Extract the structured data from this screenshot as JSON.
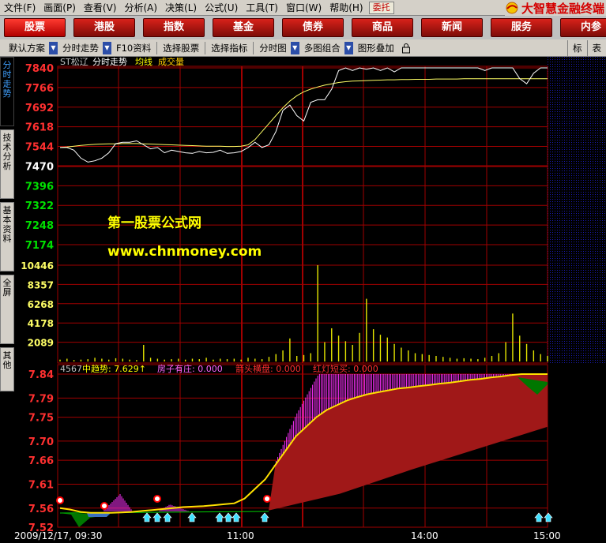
{
  "menu": [
    "文件(F)",
    "画面(P)",
    "查看(V)",
    "分析(A)",
    "决策(L)",
    "公式(U)",
    "工具(T)",
    "窗口(W)",
    "帮助(H)"
  ],
  "entrust": "委托",
  "brand": "大智慧金融终端",
  "nav": [
    "股票",
    "港股",
    "指数",
    "基金",
    "债券",
    "商品",
    "新闻",
    "服务",
    "内参"
  ],
  "toolbar": {
    "default_scheme": "默认方案",
    "timeshare": "分时走势",
    "f10": "F10资料",
    "select_stock": "选择股票",
    "select_indicator": "选择指标",
    "timeshare_chart": "分时图",
    "multi_combo": "多图组合",
    "overlay": "图形叠加",
    "mark": "标",
    "table": "表"
  },
  "side_tabs": [
    "分时走势",
    "技术分析",
    "基本资料",
    "全屏",
    "其他"
  ],
  "upper": {
    "header": [
      "ST松辽",
      "分时走势",
      "均线",
      "成交量"
    ],
    "price_ticks": [
      "7840",
      "7766",
      "7692",
      "7618",
      "7544",
      "7470",
      "7396",
      "7322",
      "7248",
      "7174"
    ],
    "vol_ticks": [
      "10446",
      "8357",
      "6268",
      "4178",
      "2089"
    ]
  },
  "watermark": {
    "line1": "第一股票公式网",
    "line2": "www.chnmoney.com"
  },
  "lower": {
    "code": "4567",
    "ind1": "中趋势: 7.629↑",
    "ind2": "房子有庄: 0.000",
    "ind3": "箭头横盘: 0.000",
    "ind4": "红灯短买: 0.000",
    "ticks": [
      "7.84",
      "7.79",
      "7.75",
      "7.70",
      "7.66",
      "7.61",
      "7.56",
      "7.52"
    ]
  },
  "xaxis": {
    "date": "2009/12/17, 09:30",
    "t1": "11:00",
    "t2": "14:00",
    "t3": "15:00"
  },
  "colors": {
    "up": "#ff3030",
    "down": "#00e000",
    "grid": "#a00000",
    "volume": "#e6e600",
    "avg": "#ffff66",
    "price": "#ffffff",
    "trend": "#ffe000",
    "fill": "#a01818",
    "magenta": "#ff30ff",
    "green": "#007700"
  },
  "chart_data": {
    "type": "line",
    "price_y_range": [
      7140,
      7840
    ],
    "price": [
      7540,
      7540,
      7530,
      7500,
      7485,
      7490,
      7500,
      7520,
      7555,
      7560,
      7560,
      7565,
      7550,
      7535,
      7540,
      7520,
      7530,
      7525,
      7520,
      7518,
      7525,
      7520,
      7522,
      7530,
      7518,
      7520,
      7525,
      7540,
      7560,
      7540,
      7550,
      7600,
      7680,
      7700,
      7660,
      7640,
      7710,
      7720,
      7720,
      7760,
      7830,
      7840,
      7830,
      7840,
      7835,
      7840,
      7830,
      7840,
      7825,
      7840,
      7840,
      7840,
      7840,
      7840,
      7840,
      7840,
      7840,
      7840,
      7840,
      7840,
      7840,
      7830,
      7840,
      7840,
      7840,
      7840,
      7800,
      7780,
      7820,
      7840,
      7840
    ],
    "avg": [
      7540,
      7542,
      7545,
      7548,
      7550,
      7552,
      7553,
      7554,
      7554,
      7555,
      7555,
      7555,
      7554,
      7553,
      7552,
      7551,
      7550,
      7549,
      7548,
      7547,
      7546,
      7545,
      7545,
      7545,
      7544,
      7544,
      7545,
      7550,
      7570,
      7600,
      7630,
      7660,
      7690,
      7715,
      7735,
      7750,
      7760,
      7768,
      7775,
      7780,
      7785,
      7788,
      7790,
      7791,
      7792,
      7793,
      7794,
      7795,
      7795,
      7796,
      7796,
      7797,
      7797,
      7797,
      7798,
      7798,
      7798,
      7798,
      7799,
      7799,
      7799,
      7799,
      7799,
      7799,
      7799,
      7799,
      7799,
      7799,
      7799,
      7799,
      7799
    ],
    "volume": [
      200,
      300,
      150,
      200,
      250,
      400,
      300,
      200,
      350,
      300,
      200,
      150,
      1800,
      400,
      300,
      200,
      250,
      300,
      200,
      300,
      250,
      400,
      200,
      300,
      250,
      300,
      200,
      400,
      300,
      250,
      500,
      800,
      1200,
      2500,
      600,
      700,
      900,
      10446,
      2100,
      3600,
      2800,
      2200,
      1800,
      3100,
      6800,
      3500,
      2900,
      2600,
      1900,
      1500,
      1200,
      900,
      800,
      700,
      600,
      500,
      400,
      300,
      350,
      300,
      250,
      400,
      600,
      900,
      2100,
      5200,
      2800,
      1900,
      1200,
      800,
      600
    ],
    "lower_y_range": [
      7.52,
      7.84
    ],
    "trend_values": [
      7.56,
      7.557,
      7.552,
      7.55,
      7.55,
      7.55,
      7.551,
      7.552,
      7.554,
      7.556,
      7.558,
      7.56,
      7.562,
      7.563,
      7.564,
      7.566,
      7.568,
      7.57,
      7.58,
      7.6,
      7.62,
      7.65,
      7.68,
      7.71,
      7.73,
      7.75,
      7.765,
      7.775,
      7.785,
      7.792,
      7.798,
      7.802,
      7.806,
      7.81,
      7.812,
      7.815,
      7.817,
      7.82,
      7.822,
      7.825,
      7.828,
      7.83,
      7.833,
      7.835,
      7.838,
      7.84
    ]
  }
}
